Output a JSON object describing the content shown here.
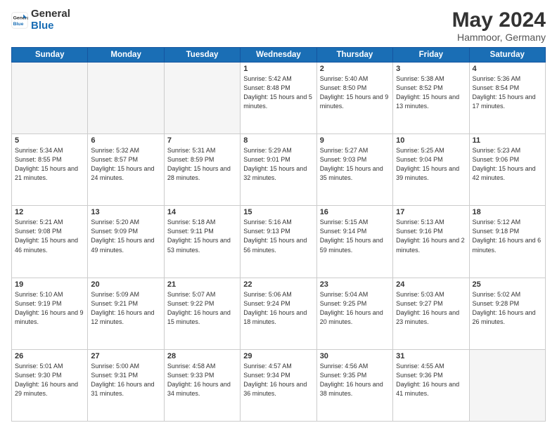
{
  "logo": {
    "line1": "General",
    "line2": "Blue"
  },
  "header": {
    "month_year": "May 2024",
    "location": "Hammoor, Germany"
  },
  "days_of_week": [
    "Sunday",
    "Monday",
    "Tuesday",
    "Wednesday",
    "Thursday",
    "Friday",
    "Saturday"
  ],
  "weeks": [
    [
      {
        "day": "",
        "empty": true
      },
      {
        "day": "",
        "empty": true
      },
      {
        "day": "",
        "empty": true
      },
      {
        "day": "1",
        "sunrise": "5:42 AM",
        "sunset": "8:48 PM",
        "daylight": "15 hours and 5 minutes."
      },
      {
        "day": "2",
        "sunrise": "5:40 AM",
        "sunset": "8:50 PM",
        "daylight": "15 hours and 9 minutes."
      },
      {
        "day": "3",
        "sunrise": "5:38 AM",
        "sunset": "8:52 PM",
        "daylight": "15 hours and 13 minutes."
      },
      {
        "day": "4",
        "sunrise": "5:36 AM",
        "sunset": "8:54 PM",
        "daylight": "15 hours and 17 minutes."
      }
    ],
    [
      {
        "day": "5",
        "sunrise": "5:34 AM",
        "sunset": "8:55 PM",
        "daylight": "15 hours and 21 minutes."
      },
      {
        "day": "6",
        "sunrise": "5:32 AM",
        "sunset": "8:57 PM",
        "daylight": "15 hours and 24 minutes."
      },
      {
        "day": "7",
        "sunrise": "5:31 AM",
        "sunset": "8:59 PM",
        "daylight": "15 hours and 28 minutes."
      },
      {
        "day": "8",
        "sunrise": "5:29 AM",
        "sunset": "9:01 PM",
        "daylight": "15 hours and 32 minutes."
      },
      {
        "day": "9",
        "sunrise": "5:27 AM",
        "sunset": "9:03 PM",
        "daylight": "15 hours and 35 minutes."
      },
      {
        "day": "10",
        "sunrise": "5:25 AM",
        "sunset": "9:04 PM",
        "daylight": "15 hours and 39 minutes."
      },
      {
        "day": "11",
        "sunrise": "5:23 AM",
        "sunset": "9:06 PM",
        "daylight": "15 hours and 42 minutes."
      }
    ],
    [
      {
        "day": "12",
        "sunrise": "5:21 AM",
        "sunset": "9:08 PM",
        "daylight": "15 hours and 46 minutes."
      },
      {
        "day": "13",
        "sunrise": "5:20 AM",
        "sunset": "9:09 PM",
        "daylight": "15 hours and 49 minutes."
      },
      {
        "day": "14",
        "sunrise": "5:18 AM",
        "sunset": "9:11 PM",
        "daylight": "15 hours and 53 minutes."
      },
      {
        "day": "15",
        "sunrise": "5:16 AM",
        "sunset": "9:13 PM",
        "daylight": "15 hours and 56 minutes."
      },
      {
        "day": "16",
        "sunrise": "5:15 AM",
        "sunset": "9:14 PM",
        "daylight": "15 hours and 59 minutes."
      },
      {
        "day": "17",
        "sunrise": "5:13 AM",
        "sunset": "9:16 PM",
        "daylight": "16 hours and 2 minutes."
      },
      {
        "day": "18",
        "sunrise": "5:12 AM",
        "sunset": "9:18 PM",
        "daylight": "16 hours and 6 minutes."
      }
    ],
    [
      {
        "day": "19",
        "sunrise": "5:10 AM",
        "sunset": "9:19 PM",
        "daylight": "16 hours and 9 minutes."
      },
      {
        "day": "20",
        "sunrise": "5:09 AM",
        "sunset": "9:21 PM",
        "daylight": "16 hours and 12 minutes."
      },
      {
        "day": "21",
        "sunrise": "5:07 AM",
        "sunset": "9:22 PM",
        "daylight": "16 hours and 15 minutes."
      },
      {
        "day": "22",
        "sunrise": "5:06 AM",
        "sunset": "9:24 PM",
        "daylight": "16 hours and 18 minutes."
      },
      {
        "day": "23",
        "sunrise": "5:04 AM",
        "sunset": "9:25 PM",
        "daylight": "16 hours and 20 minutes."
      },
      {
        "day": "24",
        "sunrise": "5:03 AM",
        "sunset": "9:27 PM",
        "daylight": "16 hours and 23 minutes."
      },
      {
        "day": "25",
        "sunrise": "5:02 AM",
        "sunset": "9:28 PM",
        "daylight": "16 hours and 26 minutes."
      }
    ],
    [
      {
        "day": "26",
        "sunrise": "5:01 AM",
        "sunset": "9:30 PM",
        "daylight": "16 hours and 29 minutes."
      },
      {
        "day": "27",
        "sunrise": "5:00 AM",
        "sunset": "9:31 PM",
        "daylight": "16 hours and 31 minutes."
      },
      {
        "day": "28",
        "sunrise": "4:58 AM",
        "sunset": "9:33 PM",
        "daylight": "16 hours and 34 minutes."
      },
      {
        "day": "29",
        "sunrise": "4:57 AM",
        "sunset": "9:34 PM",
        "daylight": "16 hours and 36 minutes."
      },
      {
        "day": "30",
        "sunrise": "4:56 AM",
        "sunset": "9:35 PM",
        "daylight": "16 hours and 38 minutes."
      },
      {
        "day": "31",
        "sunrise": "4:55 AM",
        "sunset": "9:36 PM",
        "daylight": "16 hours and 41 minutes."
      },
      {
        "day": "",
        "empty": true
      }
    ]
  ]
}
